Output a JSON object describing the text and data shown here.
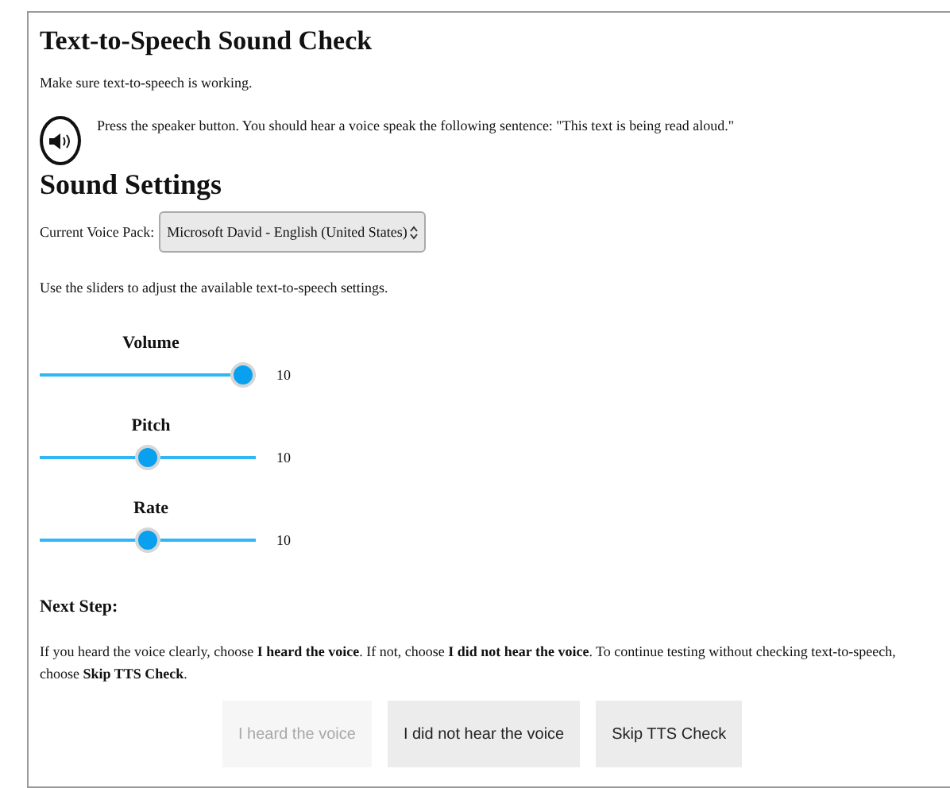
{
  "title": "Text-to-Speech Sound Check",
  "intro": "Make sure text-to-speech is working.",
  "speaker_instruction": "Press the speaker button. You should hear a voice speak the following sentence: \"This text is being read aloud.\"",
  "settings_heading": "Sound Settings",
  "voice_pack": {
    "label": "Current Voice Pack:",
    "value": "Microsoft David - English (United States)"
  },
  "sliders_hint": "Use the sliders to adjust the available text-to-speech settings.",
  "sliders": [
    {
      "name": "Volume",
      "level": 1,
      "reading": "10"
    },
    {
      "name": "Pitch",
      "level": 0.5,
      "reading": "10"
    },
    {
      "name": "Rate",
      "level": 0.5,
      "reading": "10"
    }
  ],
  "next_step": {
    "heading": "Next Step:",
    "text": "If you heard the voice clearly, choose **I heard the voice**. If not, choose **I did not hear the voice**. To continue testing without checking text-to-speech, choose **Skip TTS Check**."
  },
  "buttons": [
    {
      "label": "I heard the voice",
      "disabled": true
    },
    {
      "label": "I did not hear the voice",
      "disabled": false
    },
    {
      "label": "Skip TTS Check",
      "disabled": false
    }
  ]
}
